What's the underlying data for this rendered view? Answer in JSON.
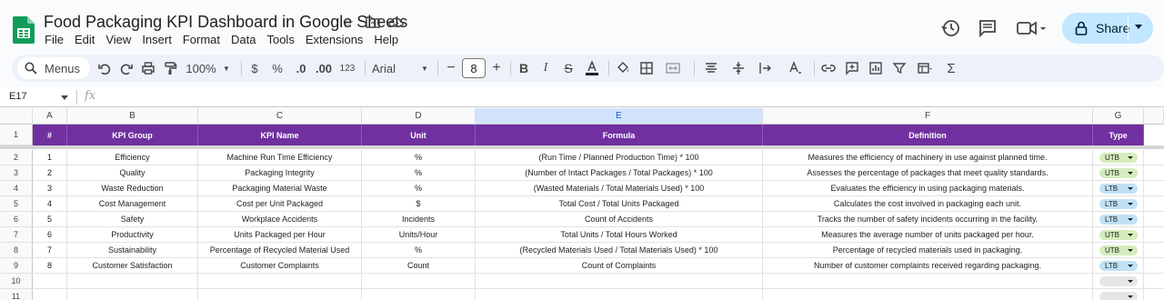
{
  "app": {
    "doc_title": "Food Packaging KPI Dashboard in Google Sheets",
    "menu": [
      "File",
      "Edit",
      "View",
      "Insert",
      "Format",
      "Data",
      "Tools",
      "Extensions",
      "Help"
    ],
    "share_label": "Share",
    "brand_color": "#0f9d58"
  },
  "toolbar": {
    "menus_label": "Menus",
    "zoom": "100%",
    "currency": "$",
    "percent": "%",
    "dec_decrease": ".0",
    "dec_increase": ".00",
    "number_format": "123",
    "font": "Arial",
    "font_size": "8",
    "minus": "−",
    "plus": "+"
  },
  "formula_bar": {
    "cell_ref": "E17",
    "fx": "fx"
  },
  "columns": [
    "A",
    "B",
    "C",
    "D",
    "E",
    "F",
    "G"
  ],
  "selected_column": "E",
  "header_color": "#7030a0",
  "table": {
    "headers": [
      "#",
      "KPI Group",
      "KPI Name",
      "Unit",
      "Formula",
      "Definition",
      "Type"
    ],
    "rows": [
      [
        "1",
        "Efficiency",
        "Machine Run Time Efficiency",
        "%",
        "(Run Time / Planned Production Time) * 100",
        "Measures the efficiency of machinery in use against planned time.",
        "UTB"
      ],
      [
        "2",
        "Quality",
        "Packaging Integrity",
        "%",
        "(Number of Intact Packages / Total Packages) * 100",
        "Assesses the percentage of packages that meet quality standards.",
        "UTB"
      ],
      [
        "3",
        "Waste Reduction",
        "Packaging Material Waste",
        "%",
        "(Wasted Materials / Total Materials Used) * 100",
        "Evaluates the efficiency in using packaging materials.",
        "LTB"
      ],
      [
        "4",
        "Cost Management",
        "Cost per Unit Packaged",
        "$",
        "Total Cost / Total Units Packaged",
        "Calculates the cost involved in packaging each unit.",
        "LTB"
      ],
      [
        "5",
        "Safety",
        "Workplace Accidents",
        "Incidents",
        "Count of Accidents",
        "Tracks the number of safety incidents occurring in the facility.",
        "LTB"
      ],
      [
        "6",
        "Productivity",
        "Units Packaged per Hour",
        "Units/Hour",
        "Total Units / Total Hours Worked",
        "Measures the average number of units packaged per hour.",
        "UTB"
      ],
      [
        "7",
        "Sustainability",
        "Percentage of Recycled Material Used",
        "%",
        "(Recycled Materials Used / Total Materials Used) * 100",
        "Percentage of recycled materials used in packaging.",
        "UTB"
      ],
      [
        "8",
        "Customer Satisfaction",
        "Customer Complaints",
        "Count",
        "Count of Complaints",
        "Number of customer complaints received regarding packaging.",
        "LTB"
      ]
    ],
    "row_numbers": [
      "1",
      "2",
      "3",
      "4",
      "5",
      "6",
      "7",
      "8",
      "9",
      "10",
      "11"
    ],
    "type_colors": {
      "UTB": "#d4edbc",
      "LTB": "#bfe1f6",
      "empty": "#e6e6e6"
    }
  }
}
